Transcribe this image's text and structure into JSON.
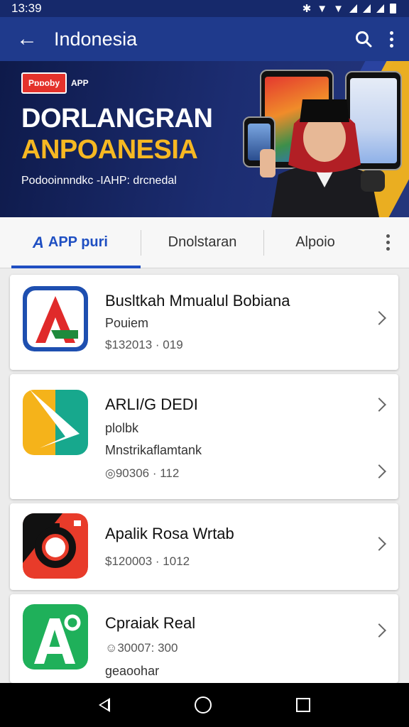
{
  "status_bar": {
    "time": "13:39"
  },
  "app_bar": {
    "title": "Indonesia"
  },
  "banner": {
    "logo_text": "Pɒɒoby",
    "logo_app": "APP",
    "headline_1": "DORLANGRAN",
    "headline_2": "ANPOANESIA",
    "subtitle": "Podooinnndkc -IAHP: drcnedal"
  },
  "tabs": [
    {
      "label": "APP puri",
      "icon": "A",
      "active": true
    },
    {
      "label": "Dnolstaran",
      "active": false
    },
    {
      "label": "Alpoio",
      "active": false
    }
  ],
  "apps": [
    {
      "title": "Busltkah Mmualul Bobiana",
      "line1": "Pouiem",
      "meta": "$132013 · 019"
    },
    {
      "title": "ARLI/G DEDI",
      "line1": "plolbk",
      "line2": "Mnstrikaflamtank",
      "meta": "◎90306 · 112"
    },
    {
      "title": "Apalik Rosa Wrtab",
      "meta": "$120003 · 1012"
    },
    {
      "title": "Cpraiak Real",
      "line1": "☺30007: 300",
      "meta": "geaoohar"
    }
  ],
  "colors": {
    "app_bar": "#1f3a8c",
    "accent": "#1f4fc2",
    "banner_yellow": "#f6b822"
  }
}
